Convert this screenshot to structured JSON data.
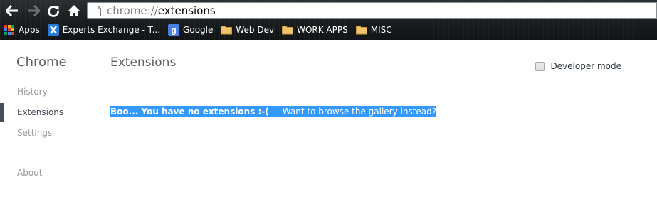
{
  "toolbar": {
    "url_scheme": "chrome://",
    "url_path": "extensions"
  },
  "bookmarks": [
    {
      "label": "Apps",
      "icon": "apps-grid-icon"
    },
    {
      "label": "Experts Exchange - T...",
      "icon": "experts-exchange-icon"
    },
    {
      "label": "Google",
      "icon": "google-icon"
    },
    {
      "label": "Web Dev",
      "icon": "folder-icon"
    },
    {
      "label": "WORK APPS",
      "icon": "folder-icon"
    },
    {
      "label": "MISC",
      "icon": "folder-icon"
    }
  ],
  "sidebar": {
    "title": "Chrome",
    "items": [
      {
        "label": "History"
      },
      {
        "label": "Extensions",
        "selected": true
      },
      {
        "label": "Settings"
      },
      {
        "label": "About"
      }
    ]
  },
  "main": {
    "title": "Extensions",
    "developer_mode_label": "Developer mode",
    "developer_mode_checked": false,
    "empty_text": "Boo... You have no extensions :-(",
    "gallery_link": "Want to browse the gallery instead?"
  },
  "colors": {
    "selection": "#3399ff",
    "sidebar_selected": "#464e5a",
    "muted_text": "#999999"
  }
}
